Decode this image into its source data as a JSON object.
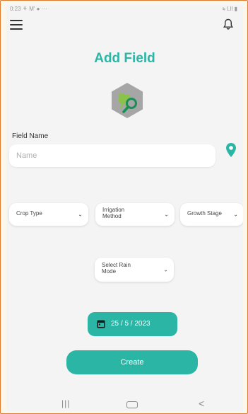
{
  "status_bar": {
    "time_icons": "0:23 ⚘ M' ● ···",
    "right_icons": "≋ Ꮮll ▮"
  },
  "header": {
    "menu_icon": "hamburger-menu-icon",
    "bell_icon": "bell-icon"
  },
  "page": {
    "title": "Add Field"
  },
  "logo": {
    "icon": "wheat-magnifier-icon",
    "bg_color": "#a6a6a6",
    "leaf_color": "#8bc34a",
    "glass_color": "#1b8d57"
  },
  "form": {
    "field_name_label": "Field Name",
    "name_placeholder": "Name",
    "location_icon": "map-pin-icon",
    "crop_type": "Crop Type",
    "irrigation_method_line1": "Irrigation",
    "irrigation_method_line2": "Method",
    "growth_stage": "Growth Stage",
    "rain_line1": "Select Rain",
    "rain_line2": "Mode",
    "date": "25 / 5 / 2023",
    "create_label": "Create"
  },
  "colors": {
    "accent": "#2ab5a5",
    "border": "#e07a2c"
  },
  "nav_bar": {
    "recents": "|||",
    "back": "<"
  }
}
